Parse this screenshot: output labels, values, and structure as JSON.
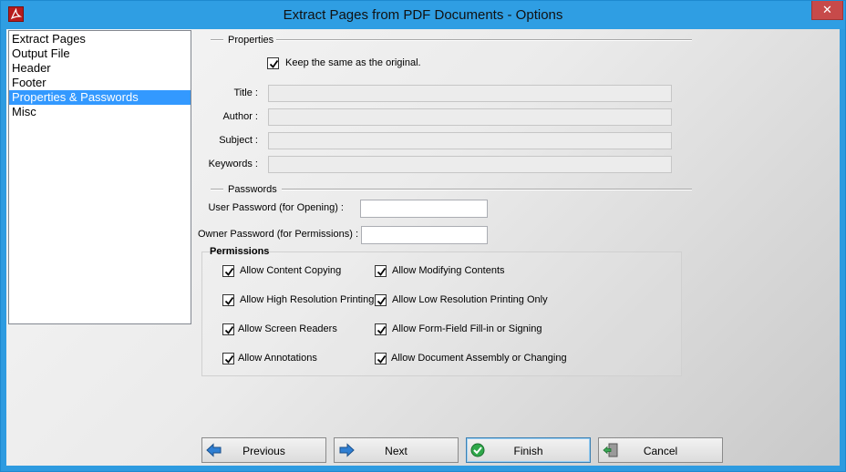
{
  "window": {
    "title": "Extract Pages from PDF Documents - Options",
    "close_glyph": "✕"
  },
  "nav": {
    "items": [
      {
        "label": "Extract Pages",
        "selected": false
      },
      {
        "label": "Output File",
        "selected": false
      },
      {
        "label": "Header",
        "selected": false
      },
      {
        "label": "Footer",
        "selected": false
      },
      {
        "label": "Properties & Passwords",
        "selected": true
      },
      {
        "label": "Misc",
        "selected": false
      }
    ]
  },
  "properties": {
    "group_label": "Properties",
    "keep_same_label": "Keep the same as the original.",
    "keep_same_checked": true,
    "fields": [
      {
        "label": "Title :",
        "value": ""
      },
      {
        "label": "Author :",
        "value": ""
      },
      {
        "label": "Subject :",
        "value": ""
      },
      {
        "label": "Keywords :",
        "value": ""
      }
    ]
  },
  "passwords": {
    "group_label": "Passwords",
    "user_label": "User Password (for Opening) :",
    "user_value": "",
    "owner_label": "Owner Password  (for Permissions) :",
    "owner_value": ""
  },
  "permissions": {
    "title": "Permissions",
    "items": [
      {
        "label": "Allow Content Copying",
        "checked": true
      },
      {
        "label": "Allow Modifying Contents",
        "checked": true
      },
      {
        "label": "Allow High Resolution Printing",
        "checked": true
      },
      {
        "label": "Allow Low Resolution Printing Only",
        "checked": true
      },
      {
        "label": "Allow Screen Readers",
        "checked": true
      },
      {
        "label": "Allow Form-Field Fill-in or Signing",
        "checked": true
      },
      {
        "label": "Allow Annotations",
        "checked": true
      },
      {
        "label": "Allow Document Assembly or Changing",
        "checked": true
      }
    ]
  },
  "buttons": {
    "previous": "Previous",
    "next": "Next",
    "finish": "Finish",
    "cancel": "Cancel"
  },
  "icons": {
    "app": "pdf-acrobat-icon",
    "previous": "arrow-left-icon",
    "next": "arrow-right-icon",
    "finish": "green-check-icon",
    "cancel": "exit-door-icon"
  },
  "colors": {
    "titlebar": "#2f9ee3",
    "selection": "#3399ff",
    "close": "#c74a4a"
  }
}
